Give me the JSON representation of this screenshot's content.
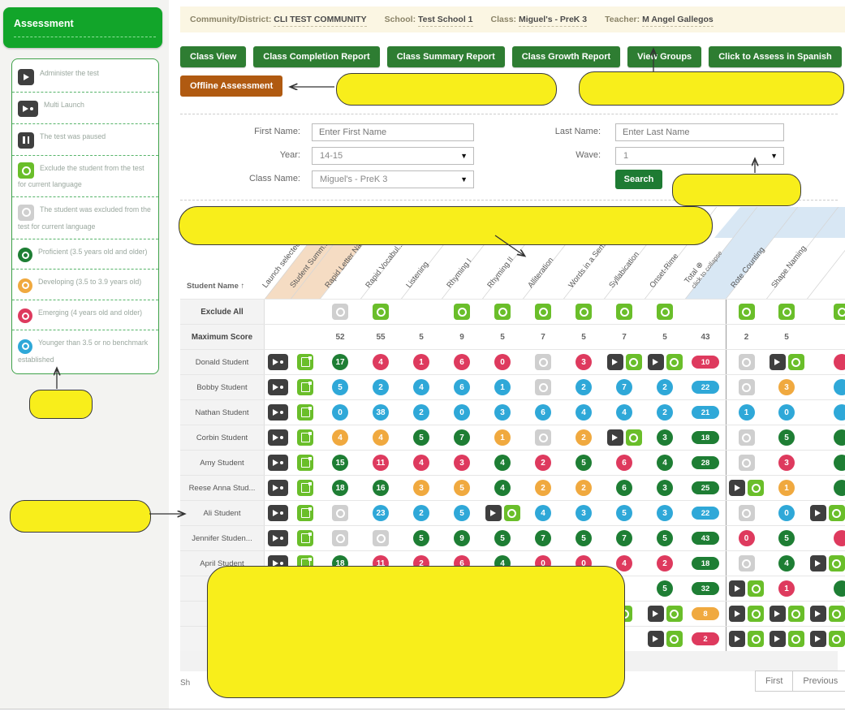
{
  "info_bar": {
    "items": [
      {
        "label": "Community/District:",
        "value": "CLI TEST COMMUNITY"
      },
      {
        "label": "School:",
        "value": "Test School 1"
      },
      {
        "label": "Class:",
        "value": "Miguel's - PreK 3"
      },
      {
        "label": "Teacher:",
        "value": "M Angel Gallegos"
      }
    ]
  },
  "toolbar": {
    "buttons": [
      "Class View",
      "Class Completion Report",
      "Class Summary Report",
      "Class Growth Report",
      "View Groups",
      "Click to Assess in Spanish"
    ],
    "offline_button": "Offline Assessment"
  },
  "sidebar": {
    "title": "Assessment",
    "legend": [
      {
        "icon": "play-icon",
        "label": "Administer the test"
      },
      {
        "icon": "multi-launch-icon",
        "label": "Multi Launch"
      },
      {
        "icon": "pause-icon",
        "label": "The test was paused"
      },
      {
        "icon": "exclude-green-icon",
        "label": "Exclude the student from the test for current language"
      },
      {
        "icon": "excluded-gray-icon",
        "label": "The student was excluded from the test for current language"
      },
      {
        "icon": "proficient-icon",
        "label": "Proficient (3.5 years old and older)"
      },
      {
        "icon": "developing-icon",
        "label": "Developing (3.5 to 3.9 years old)"
      },
      {
        "icon": "emerging-icon",
        "label": "Emerging (4 years old and older)"
      },
      {
        "icon": "younger-icon",
        "label": "Younger than 3.5 or no benchmark established"
      }
    ]
  },
  "search_form": {
    "first_name_label": "First Name:",
    "first_name_placeholder": "Enter First Name",
    "last_name_label": "Last Name:",
    "last_name_placeholder": "Enter Last Name",
    "year_label": "Year:",
    "year_value": "14-15",
    "wave_label": "Wave:",
    "wave_value": "1",
    "class_label": "Class Name:",
    "class_value": "Miguel's - PreK 3",
    "search_button": "Search"
  },
  "table": {
    "name_header": "Student Name",
    "sort_icon": "↑",
    "columns": [
      {
        "id": "launch",
        "label": "Launch selected"
      },
      {
        "id": "summary",
        "label": "Student Summ..."
      },
      {
        "id": "rln",
        "label": "Rapid Letter Na..."
      },
      {
        "id": "rv",
        "label": "Rapid Vocabul..."
      },
      {
        "id": "lis",
        "label": "Listening"
      },
      {
        "id": "rhy1",
        "label": "Rhyming I"
      },
      {
        "id": "rhy2",
        "label": "Rhyming II"
      },
      {
        "id": "alli",
        "label": "Alliteration"
      },
      {
        "id": "ws",
        "label": "Words in a Sen..."
      },
      {
        "id": "syl",
        "label": "Syllabication"
      },
      {
        "id": "or",
        "label": "Onset-Rime"
      },
      {
        "id": "total",
        "label": "Total ⊕",
        "sublabel": "click to collapse"
      },
      {
        "id": "rc",
        "label": "Rote Counting"
      },
      {
        "id": "sn",
        "label": "Shape Naming"
      },
      {
        "id": "x",
        "label": ""
      }
    ],
    "exclude_row": {
      "label": "Exclude All",
      "cells": {
        "rln": "xgr",
        "rv": "xg",
        "rhy1": "xg",
        "rhy2": "xg",
        "alli": "xg",
        "ws": "xg",
        "syl": "xg",
        "or": "xg",
        "rc": "xg",
        "sn": "xg",
        "x": "xgx"
      }
    },
    "max_row": {
      "label": "Maximum Score",
      "values": {
        "rln": "52",
        "rv": "55",
        "lis": "5",
        "rhy1": "9",
        "rhy2": "5",
        "alli": "7",
        "ws": "5",
        "syl": "7",
        "or": "5",
        "total": "43",
        "rc": "2",
        "sn": "5"
      }
    },
    "rows": [
      {
        "name": "Donald Student",
        "cells": {
          "launch": "ml",
          "summary": "sum",
          "rln": {
            "t": "num",
            "v": "17",
            "k": "P"
          },
          "rv": {
            "t": "num",
            "v": "4",
            "k": "E"
          },
          "lis": {
            "t": "num",
            "v": "1",
            "k": "E"
          },
          "rhy1": {
            "t": "num",
            "v": "6",
            "k": "E"
          },
          "rhy2": {
            "t": "num",
            "v": "0",
            "k": "E"
          },
          "alli": "xgr",
          "ws": {
            "t": "num",
            "v": "3",
            "k": "E"
          },
          "syl": "pg",
          "or": "pg",
          "total": {
            "t": "pill",
            "v": "10",
            "k": "E"
          },
          "rc": "xgr",
          "sn": "pg",
          "x": {
            "t": "xnum",
            "v": "",
            "k": "E"
          }
        }
      },
      {
        "name": "Bobby Student",
        "cells": {
          "launch": "ml",
          "summary": "sum",
          "rln": {
            "t": "num",
            "v": "5",
            "k": "Y"
          },
          "rv": {
            "t": "num",
            "v": "2",
            "k": "Y"
          },
          "lis": {
            "t": "num",
            "v": "4",
            "k": "Y"
          },
          "rhy1": {
            "t": "num",
            "v": "6",
            "k": "Y"
          },
          "rhy2": {
            "t": "num",
            "v": "1",
            "k": "Y"
          },
          "alli": "xgr",
          "ws": {
            "t": "num",
            "v": "2",
            "k": "Y"
          },
          "syl": {
            "t": "num",
            "v": "7",
            "k": "Y"
          },
          "or": {
            "t": "num",
            "v": "2",
            "k": "Y"
          },
          "total": {
            "t": "pill",
            "v": "22",
            "k": "Y"
          },
          "rc": "xgr",
          "sn": {
            "t": "num",
            "v": "3",
            "k": "D"
          },
          "x": {
            "t": "xnum",
            "v": "",
            "k": "Y"
          }
        }
      },
      {
        "name": "Nathan Student",
        "cells": {
          "launch": "ml",
          "summary": "sum",
          "rln": {
            "t": "num",
            "v": "0",
            "k": "Y"
          },
          "rv": {
            "t": "num",
            "v": "38",
            "k": "Y"
          },
          "lis": {
            "t": "num",
            "v": "2",
            "k": "Y"
          },
          "rhy1": {
            "t": "num",
            "v": "0",
            "k": "Y"
          },
          "rhy2": {
            "t": "num",
            "v": "3",
            "k": "Y"
          },
          "alli": {
            "t": "num",
            "v": "6",
            "k": "Y"
          },
          "ws": {
            "t": "num",
            "v": "4",
            "k": "Y"
          },
          "syl": {
            "t": "num",
            "v": "4",
            "k": "Y"
          },
          "or": {
            "t": "num",
            "v": "2",
            "k": "Y"
          },
          "total": {
            "t": "pill",
            "v": "21",
            "k": "Y"
          },
          "rc": {
            "t": "num",
            "v": "1",
            "k": "Y"
          },
          "sn": {
            "t": "num",
            "v": "0",
            "k": "Y"
          },
          "x": {
            "t": "xnum",
            "v": "",
            "k": "Y"
          }
        }
      },
      {
        "name": "Corbin Student",
        "cells": {
          "launch": "ml",
          "summary": "sum",
          "rln": {
            "t": "num",
            "v": "4",
            "k": "D"
          },
          "rv": {
            "t": "num",
            "v": "4",
            "k": "D"
          },
          "lis": {
            "t": "num",
            "v": "5",
            "k": "P"
          },
          "rhy1": {
            "t": "num",
            "v": "7",
            "k": "P"
          },
          "rhy2": {
            "t": "num",
            "v": "1",
            "k": "D"
          },
          "alli": "xgr",
          "ws": {
            "t": "num",
            "v": "2",
            "k": "D"
          },
          "syl": "pg",
          "or": {
            "t": "num",
            "v": "3",
            "k": "P"
          },
          "total": {
            "t": "pill",
            "v": "18",
            "k": "P"
          },
          "rc": "xgr",
          "sn": {
            "t": "num",
            "v": "5",
            "k": "P"
          },
          "x": {
            "t": "xnum",
            "v": "",
            "k": "P"
          }
        }
      },
      {
        "name": "Amy Student",
        "cells": {
          "launch": "ml",
          "summary": "sum",
          "rln": {
            "t": "num",
            "v": "15",
            "k": "P"
          },
          "rv": {
            "t": "num",
            "v": "11",
            "k": "E"
          },
          "lis": {
            "t": "num",
            "v": "4",
            "k": "E"
          },
          "rhy1": {
            "t": "num",
            "v": "3",
            "k": "E"
          },
          "rhy2": {
            "t": "num",
            "v": "4",
            "k": "P"
          },
          "alli": {
            "t": "num",
            "v": "2",
            "k": "E"
          },
          "ws": {
            "t": "num",
            "v": "5",
            "k": "P"
          },
          "syl": {
            "t": "num",
            "v": "6",
            "k": "E"
          },
          "or": {
            "t": "num",
            "v": "4",
            "k": "P"
          },
          "total": {
            "t": "pill",
            "v": "28",
            "k": "P"
          },
          "rc": "xgr",
          "sn": {
            "t": "num",
            "v": "3",
            "k": "E"
          },
          "x": {
            "t": "xnum",
            "v": "",
            "k": "P"
          }
        }
      },
      {
        "name": "Reese Anna Stud...",
        "cells": {
          "launch": "ml",
          "summary": "sum",
          "rln": {
            "t": "num",
            "v": "18",
            "k": "P"
          },
          "rv": {
            "t": "num",
            "v": "16",
            "k": "P"
          },
          "lis": {
            "t": "num",
            "v": "3",
            "k": "D"
          },
          "rhy1": {
            "t": "num",
            "v": "5",
            "k": "D"
          },
          "rhy2": {
            "t": "num",
            "v": "4",
            "k": "P"
          },
          "alli": {
            "t": "num",
            "v": "2",
            "k": "D"
          },
          "ws": {
            "t": "num",
            "v": "2",
            "k": "D"
          },
          "syl": {
            "t": "num",
            "v": "6",
            "k": "P"
          },
          "or": {
            "t": "num",
            "v": "3",
            "k": "P"
          },
          "total": {
            "t": "pill",
            "v": "25",
            "k": "P"
          },
          "rc": "pg",
          "sn": {
            "t": "num",
            "v": "1",
            "k": "D"
          },
          "x": {
            "t": "xnum",
            "v": "",
            "k": "P"
          }
        }
      },
      {
        "name": "Ali Student",
        "cells": {
          "launch": "ml",
          "summary": "sum",
          "rln": "xgr",
          "rv": {
            "t": "num",
            "v": "23",
            "k": "Y"
          },
          "lis": {
            "t": "num",
            "v": "2",
            "k": "Y"
          },
          "rhy1": {
            "t": "num",
            "v": "5",
            "k": "Y"
          },
          "rhy2": "pg",
          "alli": {
            "t": "num",
            "v": "4",
            "k": "Y"
          },
          "ws": {
            "t": "num",
            "v": "3",
            "k": "Y"
          },
          "syl": {
            "t": "num",
            "v": "5",
            "k": "Y"
          },
          "or": {
            "t": "num",
            "v": "3",
            "k": "Y"
          },
          "total": {
            "t": "pill",
            "v": "22",
            "k": "Y"
          },
          "rc": "xgr",
          "sn": {
            "t": "num",
            "v": "0",
            "k": "Y"
          },
          "x": "pg"
        }
      },
      {
        "name": "Jennifer Studen...",
        "cells": {
          "launch": "ml",
          "summary": "sum",
          "rln": "xgr",
          "rv": "xgr",
          "lis": {
            "t": "num",
            "v": "5",
            "k": "P"
          },
          "rhy1": {
            "t": "num",
            "v": "9",
            "k": "P"
          },
          "rhy2": {
            "t": "num",
            "v": "5",
            "k": "P"
          },
          "alli": {
            "t": "num",
            "v": "7",
            "k": "P"
          },
          "ws": {
            "t": "num",
            "v": "5",
            "k": "P"
          },
          "syl": {
            "t": "num",
            "v": "7",
            "k": "P"
          },
          "or": {
            "t": "num",
            "v": "5",
            "k": "P"
          },
          "total": {
            "t": "pill",
            "v": "43",
            "k": "P"
          },
          "rc": {
            "t": "num",
            "v": "0",
            "k": "E"
          },
          "sn": {
            "t": "num",
            "v": "5",
            "k": "P"
          },
          "x": {
            "t": "xnum",
            "v": "",
            "k": "E"
          }
        }
      },
      {
        "name": "April Student",
        "cells": {
          "launch": "ml",
          "summary": "sum",
          "rln": {
            "t": "num",
            "v": "18",
            "k": "P"
          },
          "rv": {
            "t": "num",
            "v": "11",
            "k": "E"
          },
          "lis": {
            "t": "num",
            "v": "2",
            "k": "E"
          },
          "rhy1": {
            "t": "num",
            "v": "6",
            "k": "E"
          },
          "rhy2": {
            "t": "num",
            "v": "4",
            "k": "P"
          },
          "alli": {
            "t": "num",
            "v": "0",
            "k": "E"
          },
          "ws": {
            "t": "num",
            "v": "0",
            "k": "E"
          },
          "syl": {
            "t": "num",
            "v": "4",
            "k": "E"
          },
          "or": {
            "t": "num",
            "v": "2",
            "k": "E"
          },
          "total": {
            "t": "pill",
            "v": "18",
            "k": "P"
          },
          "rc": "xgr",
          "sn": {
            "t": "num",
            "v": "4",
            "k": "P"
          },
          "x": "pg"
        }
      },
      {
        "name": "",
        "cells": {
          "or": {
            "t": "num",
            "v": "5",
            "k": "P"
          },
          "total": {
            "t": "pill",
            "v": "32",
            "k": "P"
          },
          "rc": "pg",
          "sn": {
            "t": "num",
            "v": "1",
            "k": "E"
          },
          "x": {
            "t": "xnum",
            "v": "",
            "k": "P"
          }
        }
      },
      {
        "name": "",
        "cells": {
          "syl": "xg",
          "or": "pg",
          "total": {
            "t": "pill",
            "v": "8",
            "k": "D"
          },
          "rc": "pg",
          "sn": "pg",
          "x": "pg"
        }
      },
      {
        "name": "",
        "cells": {
          "or": "pg",
          "total": {
            "t": "pill",
            "v": "2",
            "k": "E"
          },
          "rc": "pg",
          "sn": "pg",
          "x": "pg"
        }
      }
    ]
  },
  "footer": {
    "showing_text": "Sh",
    "pagination": [
      "First",
      "Previous"
    ]
  },
  "colors": {
    "benchmarks": {
      "P": "#1e7e34",
      "D": "#f0a93f",
      "E": "#de3a5e",
      "Y": "#2fa8d8"
    },
    "green_button": "#2e7d32",
    "offline_button": "#b05a11",
    "assessment_button": "#12a52a",
    "exclude_green": "#6abe2a",
    "excluded_gray": "#cfcfcf",
    "annotation_yellow": "#f8ee1b",
    "info_bar_bg": "#fbf6e3",
    "launch_band": "#f5dcc3",
    "total_band": "#d8e7f4"
  }
}
